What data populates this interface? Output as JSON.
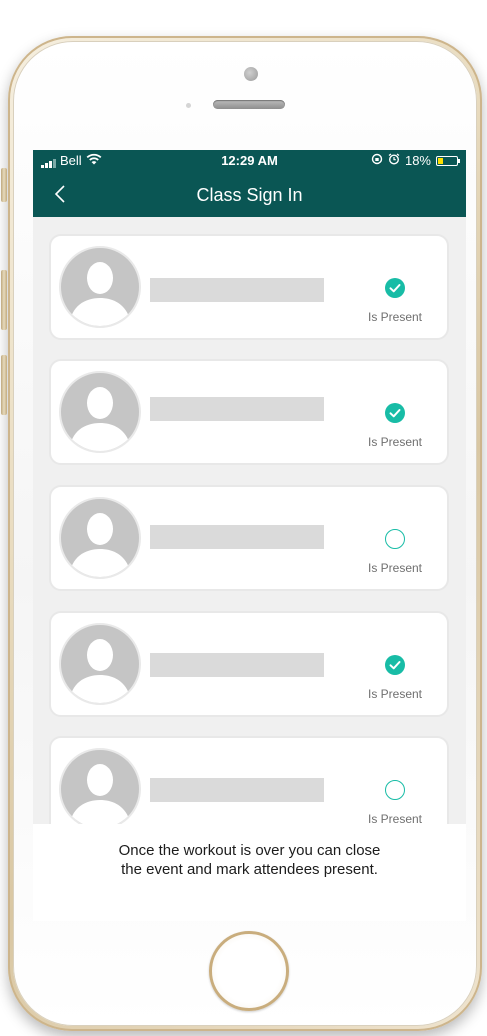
{
  "status_bar": {
    "carrier": "Bell",
    "time": "12:29 AM",
    "battery": "18%",
    "battery_level": 0.18,
    "icons": [
      "signal-icon",
      "wifi-icon",
      "orientation-lock-icon",
      "alarm-icon",
      "battery-icon"
    ]
  },
  "nav": {
    "title": "Class Sign In",
    "back_icon": "chevron-left-icon"
  },
  "attendees": [
    {
      "present": true,
      "label": "Is Present"
    },
    {
      "present": true,
      "label": "Is Present"
    },
    {
      "present": false,
      "label": "Is Present"
    },
    {
      "present": true,
      "label": "Is Present"
    },
    {
      "present": false,
      "label": "Is Present"
    }
  ],
  "footer": {
    "text": "Once the workout is over you can close the event and mark attendees present."
  },
  "colors": {
    "header": "#0a5654",
    "accent": "#18bca6",
    "battery": "#ffe000"
  }
}
